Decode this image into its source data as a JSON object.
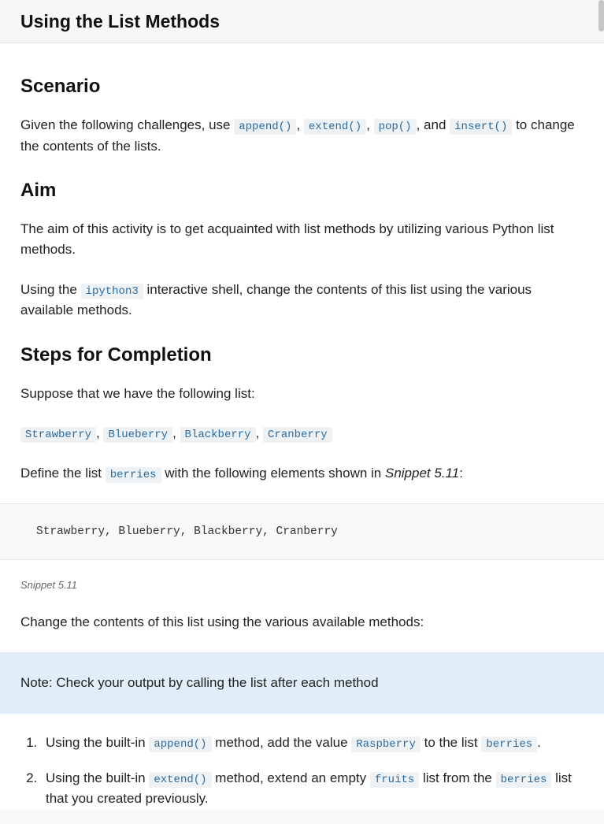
{
  "header": {
    "title": "Using the List Methods"
  },
  "scenario": {
    "heading": "Scenario",
    "intro_1": "Given the following challenges, use ",
    "m1": "append()",
    "sep1": ", ",
    "m2": "extend()",
    "sep2": ", ",
    "m3": "pop()",
    "sep3": ", and ",
    "m4": "insert()",
    "intro_2": " to change the contents of the lists."
  },
  "aim": {
    "heading": "Aim",
    "para1": "The aim of this activity is to get acquainted with list methods by utilizing various Python list methods.",
    "para2_1": "Using the ",
    "shell": "ipython3",
    "para2_2": " interactive shell, change the contents of this list using the various available methods."
  },
  "steps": {
    "heading": "Steps for Completion",
    "intro": "Suppose that we have the following list:",
    "items": {
      "i1": "Strawberry",
      "s1": ", ",
      "i2": "Blueberry",
      "s2": ", ",
      "i3": "Blackberry",
      "s3": ", ",
      "i4": "Cranberry"
    },
    "define_1": "Define the list ",
    "berries": "berries",
    "define_2": " with the following elements shown in ",
    "snippet_ref": "Snippet 5.11",
    "define_3": ":",
    "code_block": "Strawberry, Blueberry, Blackberry, Cranberry",
    "snippet_label": "Snippet 5.11",
    "change_text": "Change the contents of this list using the various available methods:",
    "note": "Note: Check your output by calling the list after each method",
    "ol": {
      "li1_1": "Using the built-in ",
      "li1_m": "append()",
      "li1_2": " method, add the value ",
      "li1_v": "Raspberry",
      "li1_3": " to the list ",
      "li1_l": "berries",
      "li1_4": ".",
      "li2_1": "Using the built-in ",
      "li2_m": "extend()",
      "li2_2": " method, extend an empty ",
      "li2_v": "fruits",
      "li2_3": " list from the ",
      "li2_l": "berries",
      "li2_4": " list that you created previously."
    }
  }
}
